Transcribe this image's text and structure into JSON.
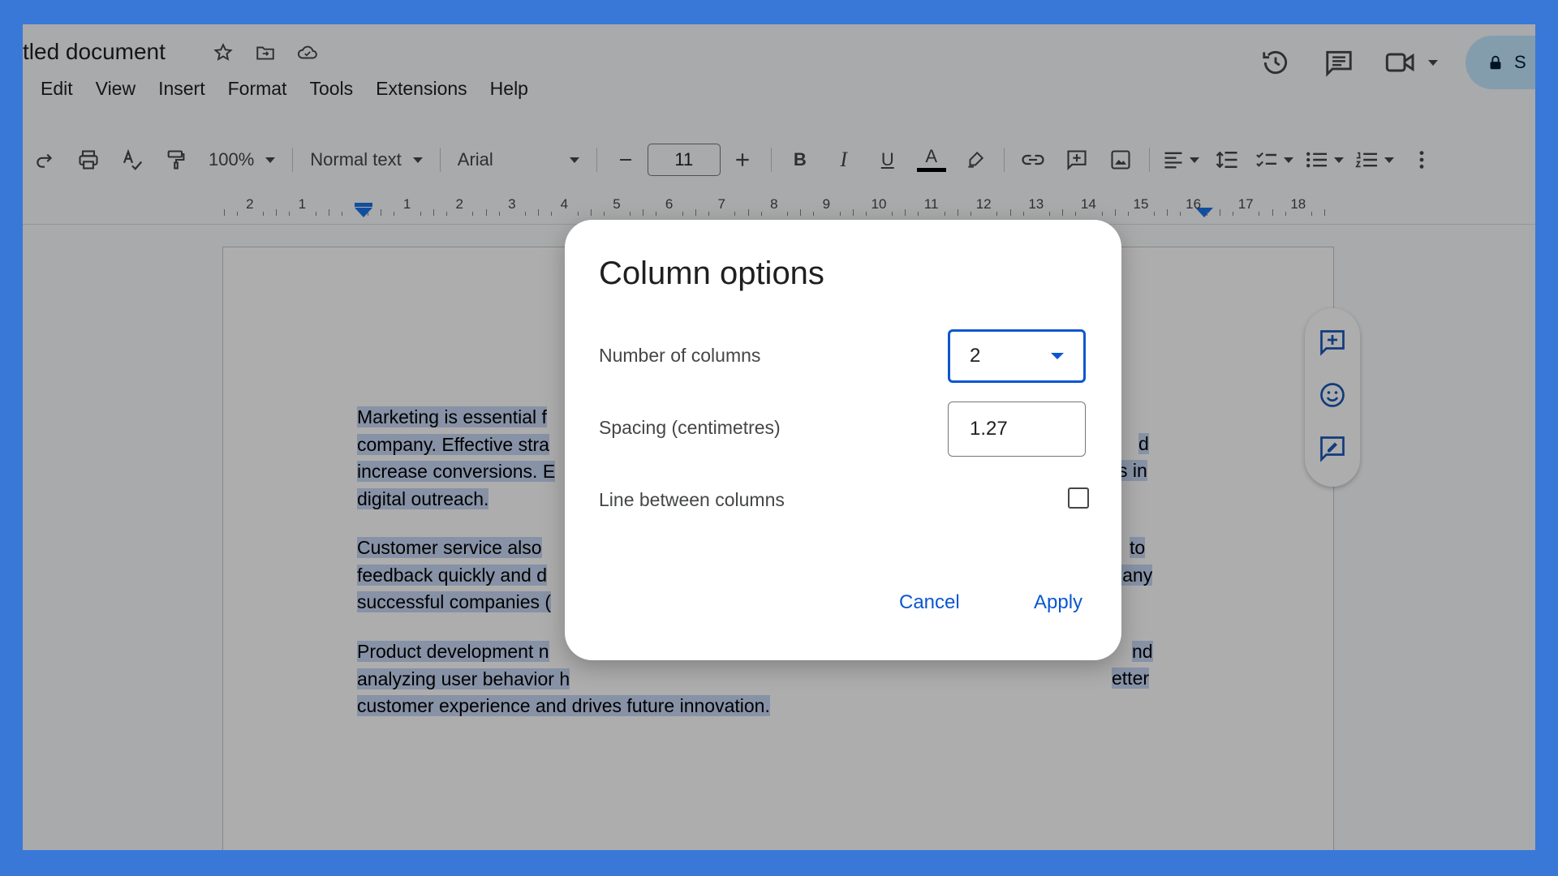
{
  "header": {
    "doc_title": "tled document",
    "menu": [
      "Edit",
      "View",
      "Insert",
      "Format",
      "Tools",
      "Extensions",
      "Help"
    ],
    "share_label": "S"
  },
  "toolbar": {
    "zoom": "100%",
    "style": "Normal text",
    "font": "Arial",
    "font_size": "11",
    "bold": "B",
    "italic": "I",
    "underline": "U",
    "text_color_glyph": "A",
    "text_color": "#000000"
  },
  "ruler": {
    "left_labels": [
      "2",
      "1"
    ],
    "right_labels": [
      "1",
      "2",
      "3",
      "4",
      "5",
      "6",
      "7",
      "8",
      "9",
      "10",
      "11",
      "12",
      "13",
      "14",
      "15",
      "16",
      "17",
      "18"
    ]
  },
  "document": {
    "paragraphs": [
      [
        "Marketing is essential f",
        "company. Effective stra",
        "increase conversions. E",
        "digital outreach."
      ],
      [
        "Customer service also ",
        "feedback quickly and d",
        "successful companies ("
      ],
      [
        "Product development n",
        "analyzing user behavior h",
        "customer experience and drives future innovation."
      ]
    ],
    "right_fragments": [
      {
        "text": "d"
      },
      {
        "text": "s in"
      },
      {
        "text": "to"
      },
      {
        "text": "lany"
      },
      {
        "text": "nd"
      },
      {
        "text": "etter"
      }
    ]
  },
  "dialog": {
    "title": "Column options",
    "num_columns_label": "Number of columns",
    "num_columns_value": "2",
    "spacing_label": "Spacing (centimetres)",
    "spacing_value": "1.27",
    "line_between_label": "Line between columns",
    "line_between_checked": false,
    "cancel_label": "Cancel",
    "apply_label": "Apply"
  },
  "colors": {
    "accent": "#0b57d0",
    "selection_highlight": "#c8d7f5",
    "frame_border": "#3a78d8"
  }
}
